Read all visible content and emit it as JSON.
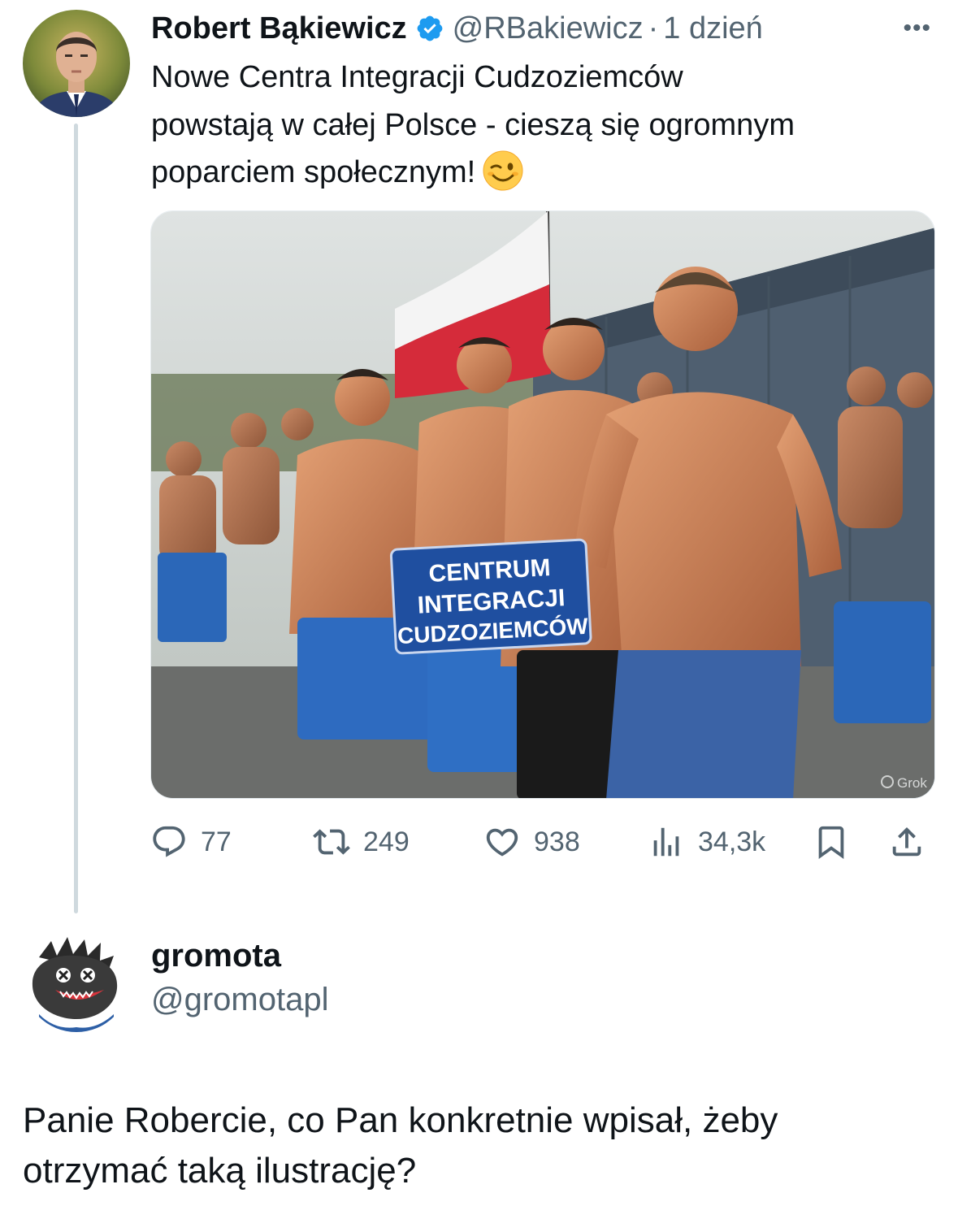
{
  "parent_tweet": {
    "author_name": "Robert Bąkiewicz",
    "handle": "@RBakiewicz",
    "separator": "·",
    "time": "1 dzień",
    "more_label": "•••",
    "text_line1": "Nowe Centra Integracji Cudzoziemców",
    "text_line2": "powstają w całej Polsce - cieszą się ogromnym",
    "text_line3": "poparciem społecznym!",
    "emoji": "winking-face",
    "media": {
      "sign_line1": "CENTRUM",
      "sign_line2": "INTEGRACJI",
      "sign_line3": "CUDZOZIEMCÓW",
      "watermark": "Grok"
    },
    "stats": {
      "replies": "77",
      "retweets": "249",
      "likes": "938",
      "views": "34,3k"
    }
  },
  "reply": {
    "author_name": "gromota",
    "handle": "@gromotapl",
    "text_line1": "Panie Robercie, co Pan konkretnie wpisał, żeby",
    "text_line2": "otrzymać taką ilustrację?"
  },
  "colors": {
    "text_primary": "#0f1419",
    "text_secondary": "#536471",
    "verified_blue": "#1d9bf0",
    "thread_line": "#cfd9de"
  }
}
